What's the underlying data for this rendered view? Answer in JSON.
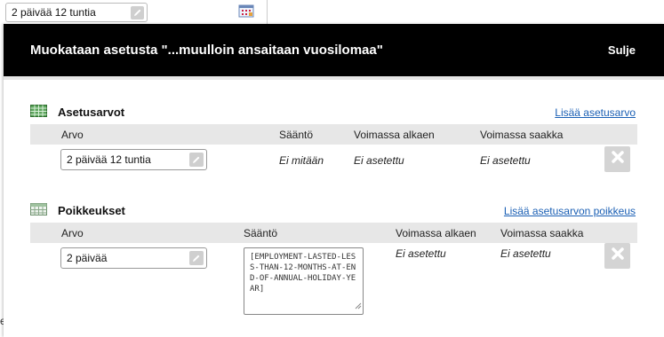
{
  "background": {
    "field_value": "2 päivää 12 tuntia",
    "partial_letter": "e"
  },
  "modal": {
    "title": "Muokataan asetusta \"...muulloin ansaitaan vuosilomaa\"",
    "close_label": "Sulje"
  },
  "settings": {
    "title": "Asetusarvot",
    "add_link": "Lisää asetusarvo",
    "columns": {
      "value": "Arvo",
      "rule": "Sääntö",
      "valid_from": "Voimassa alkaen",
      "valid_to": "Voimassa saakka"
    },
    "row": {
      "value": "2 päivää 12 tuntia",
      "rule": "Ei mitään",
      "valid_from": "Ei asetettu",
      "valid_to": "Ei asetettu"
    }
  },
  "exceptions": {
    "title": "Poikkeukset",
    "add_link": "Lisää asetusarvon poikkeus",
    "columns": {
      "value": "Arvo",
      "rule": "Sääntö",
      "valid_from": "Voimassa alkaen",
      "valid_to": "Voimassa saakka"
    },
    "row": {
      "value": "2 päivää",
      "rule": "[EMPLOYMENT-LASTED-LESS-THAN-12-MONTHS-AT-END-OF-ANNUAL-HOLIDAY-YEAR]",
      "valid_from": "Ei asetettu",
      "valid_to": "Ei asetettu"
    }
  },
  "icons": {
    "pencil": "pencil-icon",
    "delete": "close-x-icon",
    "settings_table": "table-grid-icon",
    "exceptions_table": "table-grid-icon",
    "calendar": "calendar-icon"
  },
  "colors": {
    "header_bg": "#000000",
    "link": "#1a5fb4",
    "table_header_bg": "#e7e7e7"
  }
}
